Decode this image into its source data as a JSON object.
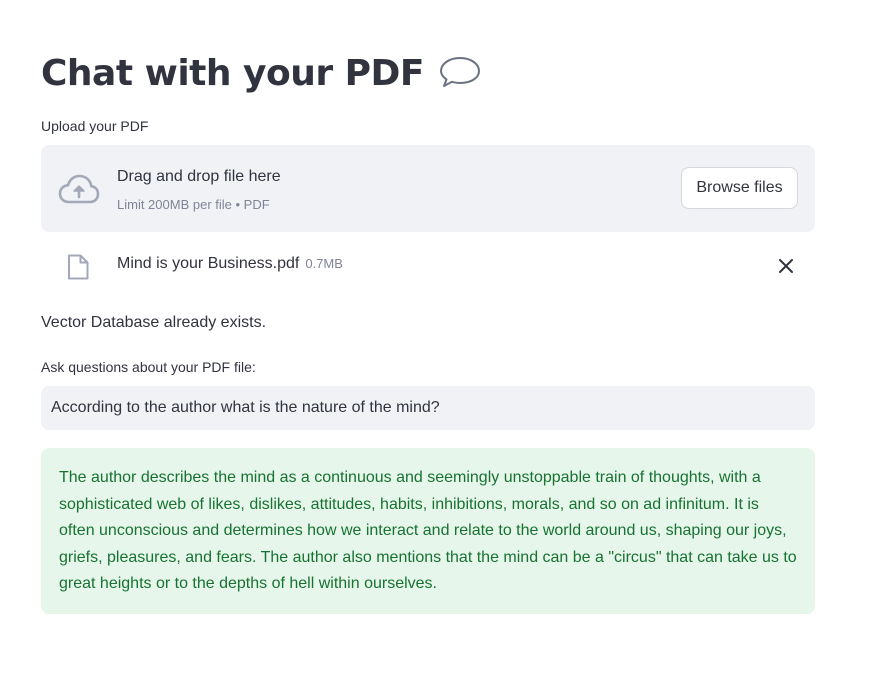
{
  "page": {
    "title": "Chat with your PDF",
    "title_icon": "speech-bubble-icon"
  },
  "uploader": {
    "label": "Upload your PDF",
    "drop_title": "Drag and drop file here",
    "drop_subtitle": "Limit 200MB per file • PDF",
    "browse_label": "Browse files",
    "icon": "cloud-upload-icon"
  },
  "file": {
    "name": "Mind is your Business.pdf",
    "size": "0.7MB",
    "icon": "file-icon",
    "remove_icon": "close-icon"
  },
  "status": {
    "message": "Vector Database already exists."
  },
  "question": {
    "label": "Ask questions about your PDF file:",
    "value": "According to the author what is the nature of the mind?"
  },
  "answer": {
    "text": "The author describes the mind as a continuous and seemingly unstoppable train of thoughts, with a sophisticated web of likes, dislikes, attitudes, habits, inhibitions, morals, and so on ad infinitum. It is often unconscious and determines how we interact and relate to the world around us, shaping our joys, griefs, pleasures, and fears. The author also mentions that the mind can be a \"circus\" that can take us to great heights or to the depths of hell within ourselves."
  },
  "colors": {
    "text": "#31333f",
    "muted": "#808495",
    "input_bg": "#f0f2f6",
    "success_bg": "#e6f6ea",
    "success_text": "#177233"
  }
}
